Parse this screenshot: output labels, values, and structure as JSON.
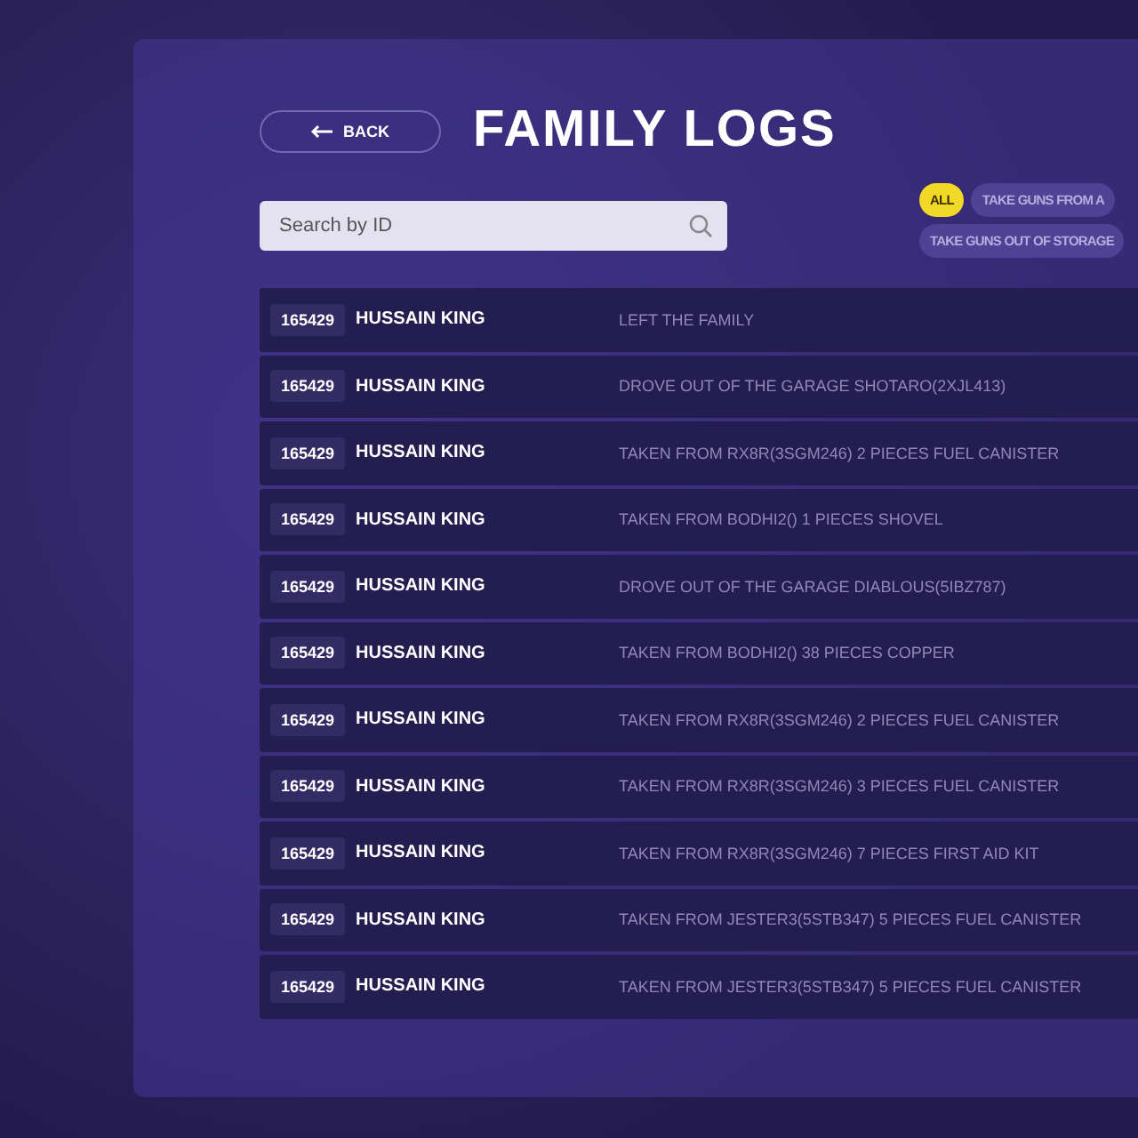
{
  "back_button": {
    "label": "BACK"
  },
  "title": "FAMILY LOGS",
  "search": {
    "placeholder": "Search by ID"
  },
  "filters": [
    {
      "label": "ALL",
      "selected": true
    },
    {
      "label": "TAKE GUNS FROM A",
      "selected": false
    },
    {
      "label": "TAKE GUNS OUT OF STORAGE",
      "selected": false
    }
  ],
  "logs": [
    {
      "id": "165429",
      "name": "HUSSAIN KING",
      "action": "LEFT THE FAMILY"
    },
    {
      "id": "165429",
      "name": "HUSSAIN KING",
      "action": "DROVE OUT OF THE GARAGE SHOTARO(2XJL413)"
    },
    {
      "id": "165429",
      "name": "HUSSAIN KING",
      "action": "TAKEN FROM RX8R(3SGM246) 2 PIECES FUEL CANISTER"
    },
    {
      "id": "165429",
      "name": "HUSSAIN KING",
      "action": "TAKEN FROM BODHI2() 1 PIECES SHOVEL"
    },
    {
      "id": "165429",
      "name": "HUSSAIN KING",
      "action": "DROVE OUT OF THE GARAGE DIABLOUS(5IBZ787)"
    },
    {
      "id": "165429",
      "name": "HUSSAIN KING",
      "action": "TAKEN FROM BODHI2() 38 PIECES COPPER"
    },
    {
      "id": "165429",
      "name": "HUSSAIN KING",
      "action": "TAKEN FROM RX8R(3SGM246) 2 PIECES FUEL CANISTER"
    },
    {
      "id": "165429",
      "name": "HUSSAIN KING",
      "action": "TAKEN FROM RX8R(3SGM246) 3 PIECES FUEL CANISTER"
    },
    {
      "id": "165429",
      "name": "HUSSAIN KING",
      "action": "TAKEN FROM RX8R(3SGM246) 7 PIECES FIRST AID KIT"
    },
    {
      "id": "165429",
      "name": "HUSSAIN KING",
      "action": "TAKEN FROM JESTER3(5STB347) 5 PIECES FUEL CANISTER"
    },
    {
      "id": "165429",
      "name": "HUSSAIN KING",
      "action": "TAKEN FROM JESTER3(5STB347) 5 PIECES FUEL CANISTER"
    }
  ]
}
